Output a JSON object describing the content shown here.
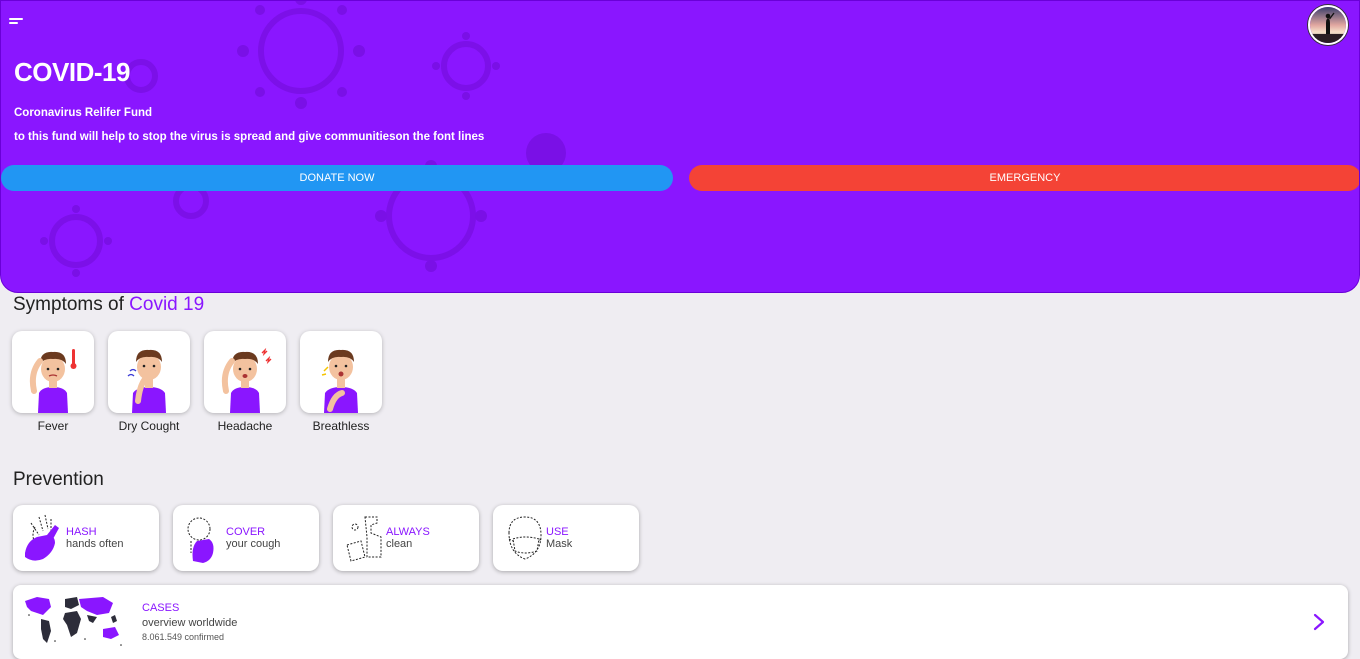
{
  "hero": {
    "title": "COVID-19",
    "subtitle": "Coronavirus Relifer Fund",
    "description": "to this fund will help to stop the virus is spread and give communitieson the font lines",
    "donate_label": "DONATE NOW",
    "emergency_label": "EMERGENCY"
  },
  "symptoms": {
    "title_prefix": "Symptoms of",
    "title_accent": "Covid 19",
    "items": [
      {
        "label": "Fever"
      },
      {
        "label": "Dry Cought"
      },
      {
        "label": "Headache"
      },
      {
        "label": "Breathless"
      }
    ]
  },
  "prevention": {
    "title": "Prevention",
    "items": [
      {
        "title": "HASH",
        "subtitle": "hands often"
      },
      {
        "title": "COVER",
        "subtitle": "your cough"
      },
      {
        "title": "ALWAYS",
        "subtitle": "clean"
      },
      {
        "title": "USE",
        "subtitle": "Mask"
      }
    ]
  },
  "cases": {
    "title": "CASES",
    "subtitle": "overview worldwide",
    "count": "8.061.549 confirmed"
  },
  "colors": {
    "primary": "#8a16ff",
    "donate": "#2196f3",
    "emergency": "#f44336",
    "background": "#efedf2"
  },
  "icons": [
    "menu-icon",
    "avatar",
    "virus-icon",
    "chevron-right-icon",
    "world-map-icon"
  ]
}
